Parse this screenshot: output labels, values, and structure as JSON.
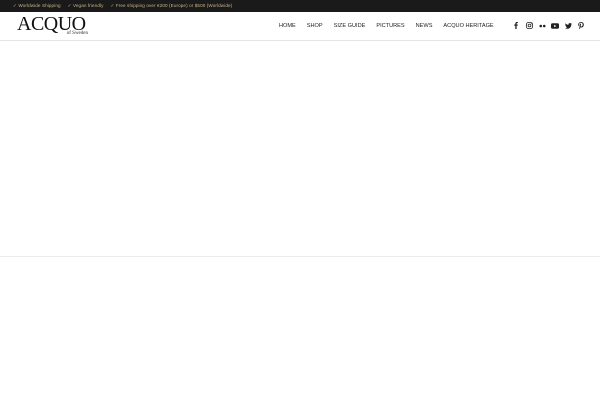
{
  "topbar": {
    "usps": [
      "✓ Worldwide Shipping",
      "✓ Vegan friendly",
      "✓ Free shipping over €200 (Europe) or $500 (Worldwide)"
    ],
    "flags": [
      {
        "name": "uk-flag-icon"
      },
      {
        "name": "france-flag-icon"
      },
      {
        "name": "germany-flag-icon"
      },
      {
        "name": "italy-flag-icon"
      },
      {
        "name": "spain-flag-icon"
      },
      {
        "name": "sweden-flag-icon"
      }
    ],
    "background_color": "#1a1a1a",
    "text_color": "#c8b58a"
  },
  "header": {
    "logo_main": "ACQUO",
    "logo_sub": "of Sweden",
    "nav": [
      "HOME",
      "SHOP",
      "SIZE GUIDE",
      "PICTURES",
      "NEWS",
      "ACQUO HERITAGE"
    ],
    "social": [
      "facebook-icon",
      "instagram-icon",
      "flickr-icon",
      "youtube-icon",
      "twitter-icon",
      "pinterest-icon"
    ]
  }
}
